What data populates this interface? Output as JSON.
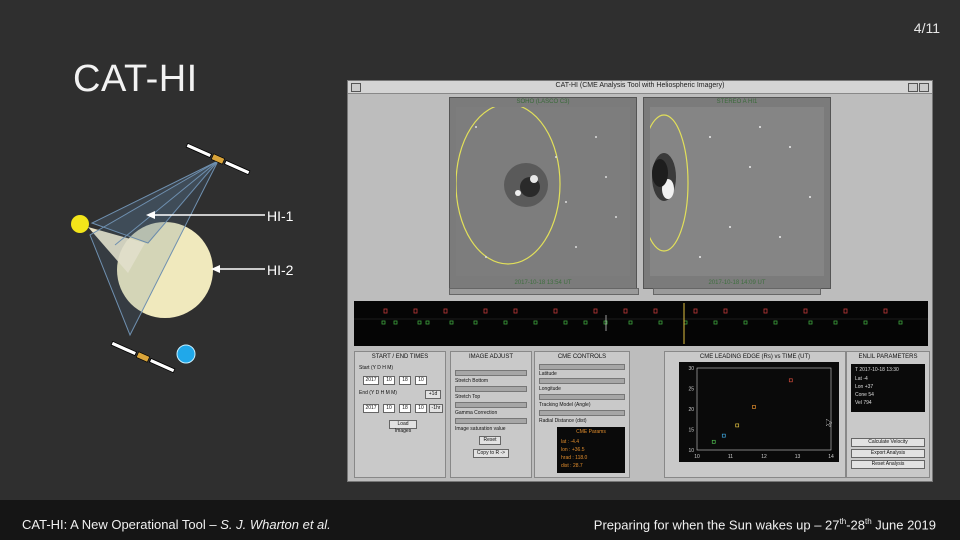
{
  "slide": {
    "number": "4/11",
    "title": "CAT-HI",
    "hi1_label": "HI-1",
    "hi2_label": "HI-2",
    "footer_left_normal": "CAT-HI: A New Operational Tool – ",
    "footer_left_italic": "S. J. Wharton et al.",
    "footer_right_a": "Preparing for when the Sun wakes up – 27",
    "footer_right_sup1": "th",
    "footer_right_b": "-28",
    "footer_right_sup2": "th",
    "footer_right_c": " June 2019"
  },
  "app": {
    "window_title": "CAT-HI (CME Analysis Tool with Heliospheric Imagery)",
    "left_image_caption": "SOHO (LASCO C3)",
    "left_image_timestamp": "2017-10-18 13:54 UT",
    "right_image_caption": "STEREO A HI1",
    "right_image_timestamp": "2017-10-18 14:09 UT",
    "start_end_panel": {
      "title": "START / END TIMES",
      "start_label": "Start (Y D H M)",
      "start_values": [
        "2017",
        "10",
        "18",
        "10"
      ],
      "end_label": "End (Y D H M M)",
      "end_values": [
        "2017",
        "10",
        "18",
        "10"
      ],
      "btn_plus": "+1d",
      "btn_minus": "-1hr",
      "load_button": "Load Images"
    },
    "image_adjust_panel": {
      "title": "IMAGE ADJUST",
      "labels": [
        "Stretch Bottom",
        "Stretch Top",
        "Gamma Correction",
        "Image saturation value"
      ],
      "reset_button": "Reset",
      "copy_button": "Copy to R ->"
    },
    "cme_controls_panel": {
      "title": "CME CONTROLS",
      "fields": [
        "Latitude",
        "Longitude",
        "Tracking Model (Angle)",
        "Radial Distance (dist)"
      ],
      "params_title": "CME Params",
      "params": [
        "lat : -4.4",
        "lon : +36.5",
        "hrad : 118.0",
        "dist : 28.7"
      ]
    },
    "chart_panel": {
      "title": "CME LEADING EDGE (Rs) vs TIME (UT)"
    },
    "enlil_panel": {
      "title": "ENLIL PARAMETERS",
      "readout": [
        "T 2017-10-18 13:30",
        "Lat -4",
        "Lon +37",
        "Cone 54",
        "Vel 794"
      ],
      "buttons": [
        "Calculate Velocity",
        "Export Analysis",
        "Reset Analysis"
      ]
    }
  },
  "chart_data": {
    "type": "scatter",
    "title": "CME LEADING EDGE (Rs) vs TIME (UT)",
    "x_ticks": [
      "10",
      "11",
      "12",
      "13",
      "14"
    ],
    "y_ticks": [
      "10",
      "15",
      "20",
      "25",
      "30"
    ],
    "xlim": [
      10,
      14
    ],
    "ylim": [
      10,
      30
    ],
    "x": [
      10.5,
      10.8,
      11.2,
      11.7,
      12.8
    ],
    "y": [
      12,
      13.5,
      16,
      20.5,
      27
    ]
  }
}
